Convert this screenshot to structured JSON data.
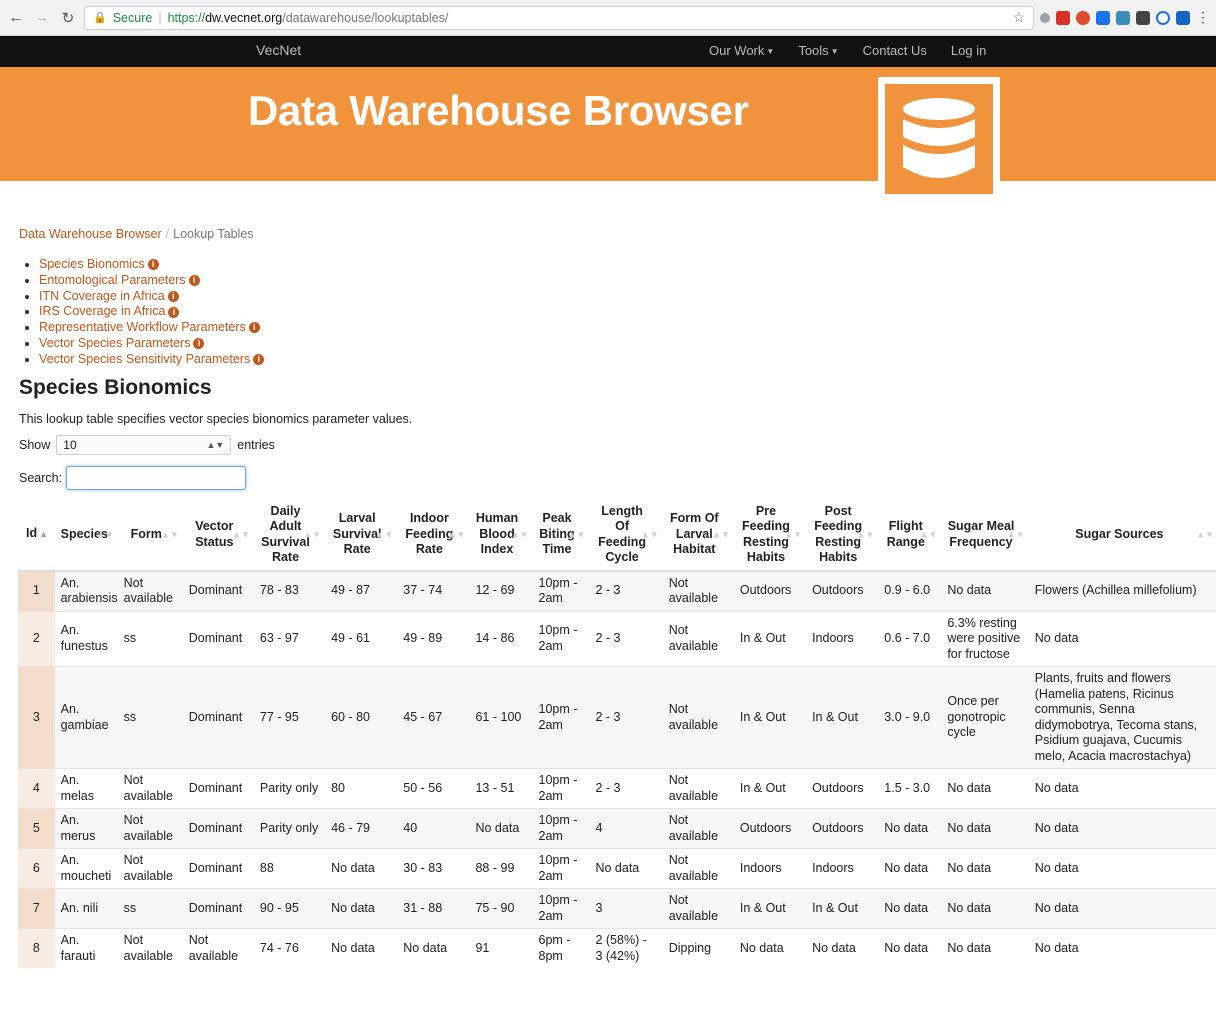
{
  "browser": {
    "secure_label": "Secure",
    "url_scheme": "https://",
    "url_host": "dw.vecnet.org",
    "url_path": "/datawarehouse/lookuptables/"
  },
  "nav": {
    "brand": "VecNet",
    "links": [
      "Our Work",
      "Tools",
      "Contact Us",
      "Log in"
    ]
  },
  "banner": {
    "title": "Data Warehouse Browser"
  },
  "breadcrumb": {
    "root": "Data Warehouse Browser",
    "current": "Lookup Tables"
  },
  "lookup_links": [
    "Species Bionomics",
    "Entomological Parameters",
    "ITN Coverage in Africa",
    "IRS Coverage in Africa",
    "Representative Workflow Parameters",
    "Vector Species Parameters",
    "Vector Species Sensitivity Parameters"
  ],
  "section": {
    "title": "Species Bionomics",
    "description": "This lookup table specifies vector species bionomics parameter values."
  },
  "controls": {
    "show_label": "Show",
    "show_value": "10",
    "entries_label": "entries",
    "search_label": "Search:",
    "search_value": ""
  },
  "table": {
    "headers": [
      "Id",
      "Species",
      "Form",
      "Vector Status",
      "Daily Adult Survival Rate",
      "Larval Survival Rate",
      "Indoor Feeding Rate",
      "Human Blood Index",
      "Peak Biting Time",
      "Length Of Feeding Cycle",
      "Form Of Larval Habitat",
      "Pre Feeding Resting Habits",
      "Post Feeding Resting Habits",
      "Flight Range",
      "Sugar Meal Frequency",
      "Sugar Sources"
    ],
    "rows": [
      [
        "1",
        "An. arabiensis",
        "Not available",
        "Dominant",
        "78 - 83",
        "49 - 87",
        "37 - 74",
        "12 - 69",
        "10pm - 2am",
        "2 - 3",
        "Not available",
        "Outdoors",
        "Outdoors",
        "0.9 - 6.0",
        "No data",
        "Flowers (Achillea millefolium)"
      ],
      [
        "2",
        "An. funestus",
        "ss",
        "Dominant",
        "63 - 97",
        "49 - 61",
        "49 - 89",
        "14 - 86",
        "10pm - 2am",
        "2 - 3",
        "Not available",
        "In & Out",
        "Indoors",
        "0.6 - 7.0",
        "6.3% resting were positive for fructose",
        "No data"
      ],
      [
        "3",
        "An. gambiae",
        "ss",
        "Dominant",
        "77 - 95",
        "60 - 80",
        "45 - 67",
        "61 - 100",
        "10pm - 2am",
        "2 - 3",
        "Not available",
        "In & Out",
        "In & Out",
        "3.0 - 9.0",
        "Once per gonotropic cycle",
        "Plants, fruits and flowers (Hamelia patens, Ricinus communis, Senna didymobotrya, Tecoma stans, Psidium guajava, Cucumis melo, Acacia macrostachya)"
      ],
      [
        "4",
        "An. melas",
        "Not available",
        "Dominant",
        "Parity only",
        "80",
        "50 - 56",
        "13 - 51",
        "10pm - 2am",
        "2 - 3",
        "Not available",
        "In & Out",
        "Outdoors",
        "1.5 - 3.0",
        "No data",
        "No data"
      ],
      [
        "5",
        "An. merus",
        "Not available",
        "Dominant",
        "Parity only",
        "46 - 79",
        "40",
        "No data",
        "10pm - 2am",
        "4",
        "Not available",
        "Outdoors",
        "Outdoors",
        "No data",
        "No data",
        "No data"
      ],
      [
        "6",
        "An. moucheti",
        "Not available",
        "Dominant",
        "88",
        "No data",
        "30 - 83",
        "88 - 99",
        "10pm - 2am",
        "No data",
        "Not available",
        "Indoors",
        "Indoors",
        "No data",
        "No data",
        "No data"
      ],
      [
        "7",
        "An. nili",
        "ss",
        "Dominant",
        "90 - 95",
        "No data",
        "31 - 88",
        "75 - 90",
        "10pm - 2am",
        "3",
        "Not available",
        "In & Out",
        "In & Out",
        "No data",
        "No data",
        "No data"
      ],
      [
        "8",
        "An. farauti",
        "Not available",
        "Not available",
        "74 - 76",
        "No data",
        "No data",
        "91",
        "6pm - 8pm",
        "2 (58%) - 3 (42%)",
        "Dipping",
        "No data",
        "No data",
        "No data",
        "No data",
        "No data"
      ]
    ]
  },
  "colors": {
    "accent": "#f0933c",
    "link": "#c0581d",
    "navbar": "#111111"
  }
}
